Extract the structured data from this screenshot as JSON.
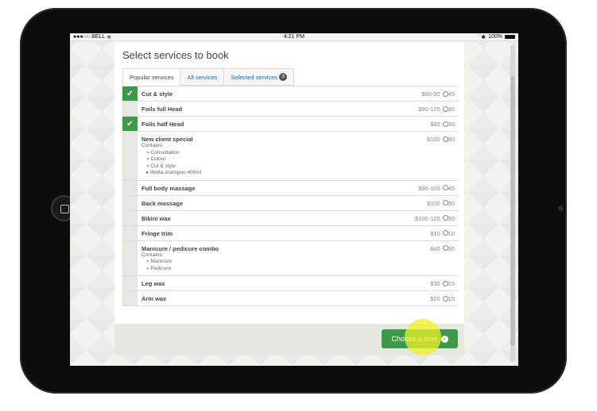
{
  "statusbar": {
    "carrier": "●●●○○ BELL",
    "wifi": "wifi-icon",
    "time": "4:21 PM",
    "bluetooth": "✱",
    "battery_text": "100%"
  },
  "page": {
    "title": "Select services to book"
  },
  "tabs": [
    {
      "label": "Popular services",
      "active": true
    },
    {
      "label": "All services",
      "active": false
    },
    {
      "label": "Selected services",
      "badge": "3",
      "active": false
    }
  ],
  "services": [
    {
      "name": "Cut & style",
      "price": "$60-90",
      "duration": "45",
      "selected": true
    },
    {
      "name": "Foils full Head",
      "price": "$90-120",
      "duration": "30",
      "selected": false
    },
    {
      "name": "Foils half Head",
      "price": "$60",
      "duration": "30",
      "selected": true
    },
    {
      "name": "New client special",
      "price": "$100",
      "duration": "90",
      "selected": false,
      "contains_label": "Contains:",
      "items": [
        "» Consultation",
        "» Colour",
        "» Cut & style",
        "Wella shampoo 400ml"
      ]
    },
    {
      "name": "Full body massage",
      "price": "$90-100",
      "duration": "45",
      "selected": false
    },
    {
      "name": "Back massage",
      "price": "$100",
      "duration": "30",
      "selected": false
    },
    {
      "name": "Bikini wax",
      "price": "$100-120",
      "duration": "30",
      "selected": false
    },
    {
      "name": "Fringe trim",
      "price": "$10",
      "duration": "10",
      "selected": false
    },
    {
      "name": "Manicure / pedicure combo",
      "price": "$40",
      "duration": "30",
      "selected": false,
      "contains_label": "Contains:",
      "items": [
        "» Manicure",
        "» Pedicure"
      ]
    },
    {
      "name": "Leg wax",
      "price": "$30",
      "duration": "15",
      "selected": false
    },
    {
      "name": "Arm wax",
      "price": "$20",
      "duration": "15",
      "selected": false
    }
  ],
  "footer": {
    "cta_label": "Choose a time"
  },
  "colors": {
    "accent_green": "#3c9a4a",
    "link_blue": "#2a6db0",
    "touch_yellow": "#f0f028"
  }
}
